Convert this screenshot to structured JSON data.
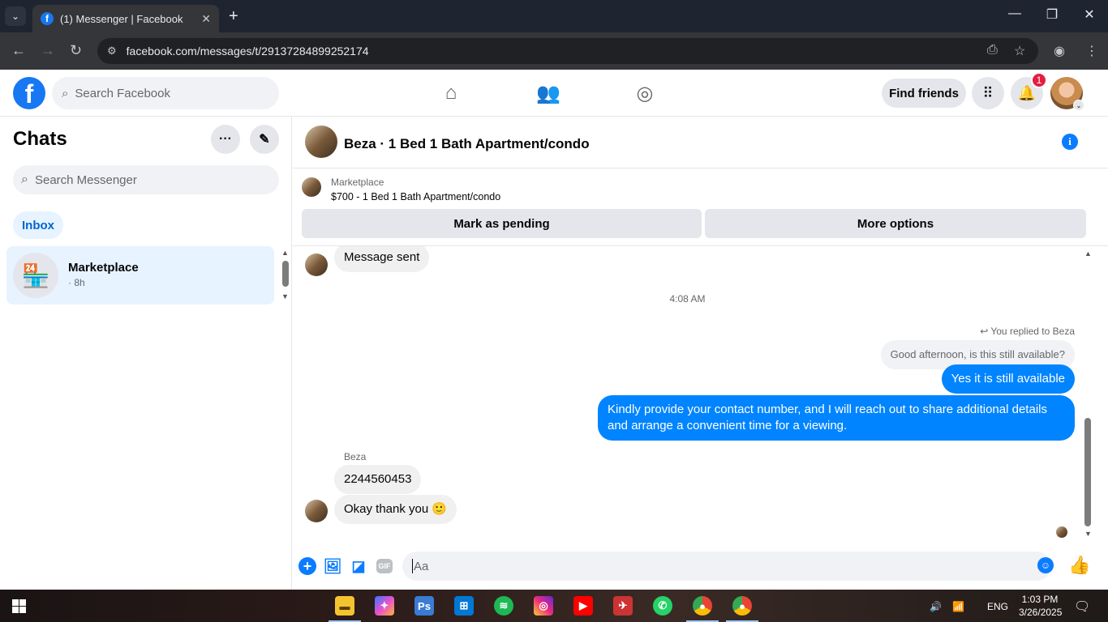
{
  "browser": {
    "tab_title": "(1) Messenger | Facebook",
    "url": "facebook.com/messages/t/29137284899252174"
  },
  "facebook": {
    "search_placeholder": "Search Facebook",
    "find_friends_label": "Find friends",
    "notification_count": "1"
  },
  "sidebar": {
    "title": "Chats",
    "search_placeholder": "Search Messenger",
    "filter_inbox": "Inbox",
    "chats": [
      {
        "name": "Marketplace",
        "meta": "· 8h"
      }
    ]
  },
  "conversation": {
    "title": "Beza · 1 Bed 1 Bath Apartment/condo",
    "marketplace_label": "Marketplace",
    "listing_price_title": "$700 - 1 Bed 1 Bath Apartment/condo",
    "mark_pending_label": "Mark as pending",
    "more_options_label": "More options",
    "messages": {
      "sent_notice": "Message sent",
      "timestamp": "4:08 AM",
      "replied_label": "You replied to Beza",
      "quoted_text": "Good afternoon, is this still available?",
      "reply_1": "Yes it is still available",
      "reply_2": "Kindly provide your contact number, and I will reach out to share additional details and arrange a convenient time for a viewing.",
      "sender_name": "Beza",
      "incoming_1": "2244560453",
      "incoming_2": "Okay thank you 🙂"
    },
    "composer_placeholder": "Aa"
  },
  "taskbar": {
    "language": "ENG",
    "time": "1:03 PM",
    "date": "3/26/2025"
  },
  "colors": {
    "facebook_blue": "#1877f2",
    "messenger_blue": "#0084ff",
    "badge_red": "#e41e3f"
  }
}
